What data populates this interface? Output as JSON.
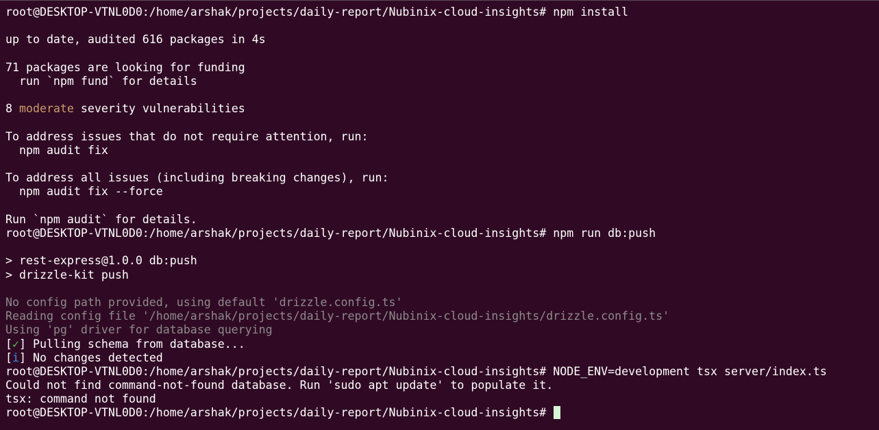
{
  "terminal": {
    "prompt": "root@DESKTOP-VTNL0D0:/home/arshak/projects/daily-report/Nubinix-cloud-insights#",
    "colors": {
      "background": "#300a24",
      "text": "#ffffff",
      "dim": "#8e8a8c",
      "moderate": "#c99b6a",
      "check": "#4ec24e",
      "info": "#3b8eea",
      "cursor": "#d6f5d6"
    },
    "commands": {
      "c1": "npm install",
      "c2": "npm run db:push",
      "c3": "NODE_ENV=development tsx server/index.ts"
    },
    "output": {
      "up_to_date": "up to date, audited 616 packages in 4s",
      "funding_1": "71 packages are looking for funding",
      "funding_2": "  run `npm fund` for details",
      "vuln_count": "8 ",
      "vuln_level": "moderate",
      "vuln_rest": " severity vulnerabilities",
      "address_1": "To address issues that do not require attention, run:",
      "address_1_cmd": "  npm audit fix",
      "address_2": "To address all issues (including breaking changes), run:",
      "address_2_cmd": "  npm audit fix --force",
      "audit_details": "Run `npm audit` for details.",
      "script_1": "> rest-express@1.0.0 db:push",
      "script_2": "> drizzle-kit push",
      "dim_1": "No config path provided, using default 'drizzle.config.ts'",
      "dim_2": "Reading config file '/home/arshak/projects/daily-report/Nubinix-cloud-insights/drizzle.config.ts'",
      "dim_3": "Using 'pg' driver for database querying",
      "pull_open": "[",
      "pull_mark": "✓",
      "pull_close": "] Pulling schema from database...",
      "info_open": "[",
      "info_mark": "i",
      "info_close": "] No changes detected",
      "cnf_1": "Could not find command-not-found database. Run 'sudo apt update' to populate it.",
      "cnf_2": "tsx: command not found"
    }
  }
}
